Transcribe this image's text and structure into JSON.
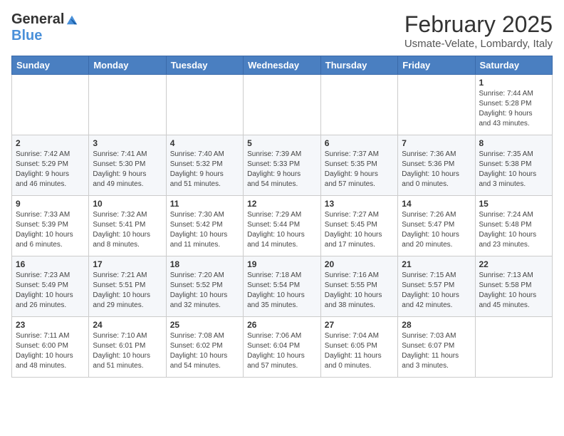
{
  "header": {
    "logo_general": "General",
    "logo_blue": "Blue",
    "month_title": "February 2025",
    "location": "Usmate-Velate, Lombardy, Italy"
  },
  "weekdays": [
    "Sunday",
    "Monday",
    "Tuesday",
    "Wednesday",
    "Thursday",
    "Friday",
    "Saturday"
  ],
  "weeks": [
    [
      {
        "day": "",
        "info": ""
      },
      {
        "day": "",
        "info": ""
      },
      {
        "day": "",
        "info": ""
      },
      {
        "day": "",
        "info": ""
      },
      {
        "day": "",
        "info": ""
      },
      {
        "day": "",
        "info": ""
      },
      {
        "day": "1",
        "info": "Sunrise: 7:44 AM\nSunset: 5:28 PM\nDaylight: 9 hours\nand 43 minutes."
      }
    ],
    [
      {
        "day": "2",
        "info": "Sunrise: 7:42 AM\nSunset: 5:29 PM\nDaylight: 9 hours\nand 46 minutes."
      },
      {
        "day": "3",
        "info": "Sunrise: 7:41 AM\nSunset: 5:30 PM\nDaylight: 9 hours\nand 49 minutes."
      },
      {
        "day": "4",
        "info": "Sunrise: 7:40 AM\nSunset: 5:32 PM\nDaylight: 9 hours\nand 51 minutes."
      },
      {
        "day": "5",
        "info": "Sunrise: 7:39 AM\nSunset: 5:33 PM\nDaylight: 9 hours\nand 54 minutes."
      },
      {
        "day": "6",
        "info": "Sunrise: 7:37 AM\nSunset: 5:35 PM\nDaylight: 9 hours\nand 57 minutes."
      },
      {
        "day": "7",
        "info": "Sunrise: 7:36 AM\nSunset: 5:36 PM\nDaylight: 10 hours\nand 0 minutes."
      },
      {
        "day": "8",
        "info": "Sunrise: 7:35 AM\nSunset: 5:38 PM\nDaylight: 10 hours\nand 3 minutes."
      }
    ],
    [
      {
        "day": "9",
        "info": "Sunrise: 7:33 AM\nSunset: 5:39 PM\nDaylight: 10 hours\nand 6 minutes."
      },
      {
        "day": "10",
        "info": "Sunrise: 7:32 AM\nSunset: 5:41 PM\nDaylight: 10 hours\nand 8 minutes."
      },
      {
        "day": "11",
        "info": "Sunrise: 7:30 AM\nSunset: 5:42 PM\nDaylight: 10 hours\nand 11 minutes."
      },
      {
        "day": "12",
        "info": "Sunrise: 7:29 AM\nSunset: 5:44 PM\nDaylight: 10 hours\nand 14 minutes."
      },
      {
        "day": "13",
        "info": "Sunrise: 7:27 AM\nSunset: 5:45 PM\nDaylight: 10 hours\nand 17 minutes."
      },
      {
        "day": "14",
        "info": "Sunrise: 7:26 AM\nSunset: 5:47 PM\nDaylight: 10 hours\nand 20 minutes."
      },
      {
        "day": "15",
        "info": "Sunrise: 7:24 AM\nSunset: 5:48 PM\nDaylight: 10 hours\nand 23 minutes."
      }
    ],
    [
      {
        "day": "16",
        "info": "Sunrise: 7:23 AM\nSunset: 5:49 PM\nDaylight: 10 hours\nand 26 minutes."
      },
      {
        "day": "17",
        "info": "Sunrise: 7:21 AM\nSunset: 5:51 PM\nDaylight: 10 hours\nand 29 minutes."
      },
      {
        "day": "18",
        "info": "Sunrise: 7:20 AM\nSunset: 5:52 PM\nDaylight: 10 hours\nand 32 minutes."
      },
      {
        "day": "19",
        "info": "Sunrise: 7:18 AM\nSunset: 5:54 PM\nDaylight: 10 hours\nand 35 minutes."
      },
      {
        "day": "20",
        "info": "Sunrise: 7:16 AM\nSunset: 5:55 PM\nDaylight: 10 hours\nand 38 minutes."
      },
      {
        "day": "21",
        "info": "Sunrise: 7:15 AM\nSunset: 5:57 PM\nDaylight: 10 hours\nand 42 minutes."
      },
      {
        "day": "22",
        "info": "Sunrise: 7:13 AM\nSunset: 5:58 PM\nDaylight: 10 hours\nand 45 minutes."
      }
    ],
    [
      {
        "day": "23",
        "info": "Sunrise: 7:11 AM\nSunset: 6:00 PM\nDaylight: 10 hours\nand 48 minutes."
      },
      {
        "day": "24",
        "info": "Sunrise: 7:10 AM\nSunset: 6:01 PM\nDaylight: 10 hours\nand 51 minutes."
      },
      {
        "day": "25",
        "info": "Sunrise: 7:08 AM\nSunset: 6:02 PM\nDaylight: 10 hours\nand 54 minutes."
      },
      {
        "day": "26",
        "info": "Sunrise: 7:06 AM\nSunset: 6:04 PM\nDaylight: 10 hours\nand 57 minutes."
      },
      {
        "day": "27",
        "info": "Sunrise: 7:04 AM\nSunset: 6:05 PM\nDaylight: 11 hours\nand 0 minutes."
      },
      {
        "day": "28",
        "info": "Sunrise: 7:03 AM\nSunset: 6:07 PM\nDaylight: 11 hours\nand 3 minutes."
      },
      {
        "day": "",
        "info": ""
      }
    ]
  ]
}
